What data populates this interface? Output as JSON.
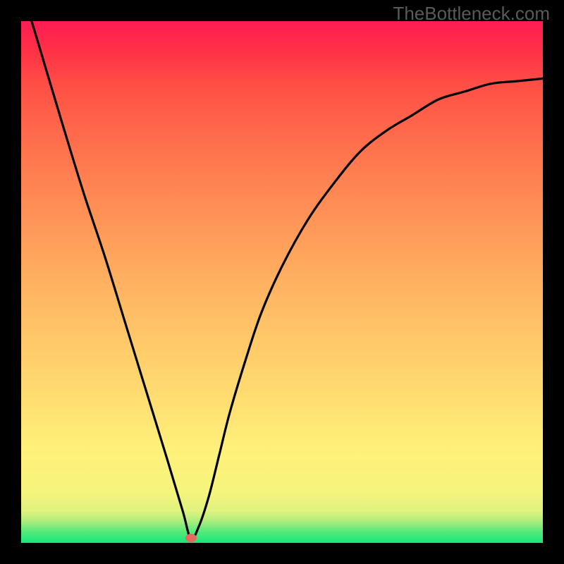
{
  "watermark": "TheBottleneck.com",
  "chart_data": {
    "type": "line",
    "title": "",
    "xlabel": "",
    "ylabel": "",
    "xlim": [
      0,
      1
    ],
    "ylim": [
      0,
      1
    ],
    "grid": false,
    "legend": false,
    "notes": "V-shaped bottleneck curve over vertical green-to-red gradient; axes are unlabeled.",
    "marker": {
      "x": 0.325,
      "y": 0.01
    },
    "series": [
      {
        "name": "bottleneck-curve",
        "x": [
          0.0,
          0.02,
          0.05,
          0.08,
          0.12,
          0.16,
          0.2,
          0.24,
          0.28,
          0.31,
          0.325,
          0.34,
          0.36,
          0.38,
          0.4,
          0.43,
          0.46,
          0.5,
          0.55,
          0.6,
          0.65,
          0.7,
          0.75,
          0.8,
          0.85,
          0.9,
          0.95,
          1.0
        ],
        "values": [
          1.06,
          1.0,
          0.9,
          0.8,
          0.67,
          0.55,
          0.42,
          0.29,
          0.16,
          0.06,
          0.008,
          0.03,
          0.09,
          0.17,
          0.25,
          0.35,
          0.44,
          0.53,
          0.62,
          0.69,
          0.75,
          0.79,
          0.82,
          0.85,
          0.865,
          0.88,
          0.885,
          0.89
        ]
      }
    ]
  }
}
